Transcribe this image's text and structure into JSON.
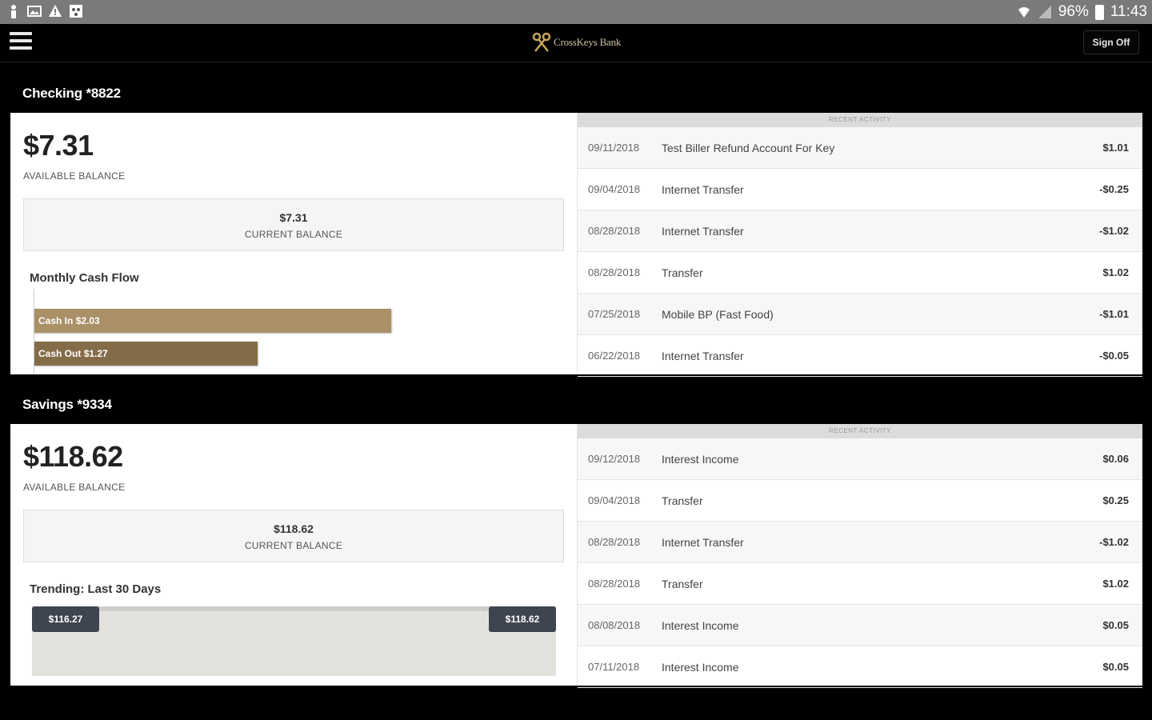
{
  "status_bar": {
    "battery": "96%",
    "time": "11:43"
  },
  "header": {
    "logo_text": "CrossKeys Bank",
    "sign_off": "Sign Off"
  },
  "accounts": [
    {
      "title": "Checking *8822",
      "available_balance": "$7.31",
      "available_label": "AVAILABLE BALANCE",
      "current_balance": "$7.31",
      "current_label": "CURRENT BALANCE",
      "chart_title": "Monthly Cash Flow",
      "cash_in_label": "Cash In",
      "cash_in_value": "$2.03",
      "cash_out_label": "Cash Out",
      "cash_out_value": "$1.27",
      "recent_label": "RECENT ACTIVITY",
      "transactions": [
        {
          "date": "09/11/2018",
          "desc": "Test Biller Refund Account For Key",
          "amount": "$1.01"
        },
        {
          "date": "09/04/2018",
          "desc": "Internet Transfer",
          "amount": "-$0.25"
        },
        {
          "date": "08/28/2018",
          "desc": "Internet Transfer",
          "amount": "-$1.02"
        },
        {
          "date": "08/28/2018",
          "desc": "Transfer",
          "amount": "$1.02"
        },
        {
          "date": "07/25/2018",
          "desc": "Mobile BP (Fast Food)",
          "amount": "-$1.01"
        },
        {
          "date": "06/22/2018",
          "desc": "Internet Transfer",
          "amount": "-$0.05"
        }
      ]
    },
    {
      "title": "Savings *9334",
      "available_balance": "$118.62",
      "available_label": "AVAILABLE BALANCE",
      "current_balance": "$118.62",
      "current_label": "CURRENT BALANCE",
      "chart_title": "Trending: Last 30 Days",
      "trend_start": "$116.27",
      "trend_end": "$118.62",
      "recent_label": "RECENT ACTIVITY",
      "transactions": [
        {
          "date": "09/12/2018",
          "desc": "Interest Income",
          "amount": "$0.06"
        },
        {
          "date": "09/04/2018",
          "desc": "Transfer",
          "amount": "$0.25"
        },
        {
          "date": "08/28/2018",
          "desc": "Internet Transfer",
          "amount": "-$1.02"
        },
        {
          "date": "08/28/2018",
          "desc": "Transfer",
          "amount": "$1.02"
        },
        {
          "date": "08/08/2018",
          "desc": "Interest Income",
          "amount": "$0.05"
        },
        {
          "date": "07/11/2018",
          "desc": "Interest Income",
          "amount": "$0.05"
        }
      ]
    }
  ],
  "chart_data": [
    {
      "type": "bar",
      "title": "Monthly Cash Flow",
      "categories": [
        "Cash In",
        "Cash Out"
      ],
      "values": [
        2.03,
        1.27
      ],
      "xlabel": "",
      "ylabel": ""
    },
    {
      "type": "area",
      "title": "Trending: Last 30 Days",
      "series": [
        {
          "values": [
            116.27,
            118.62
          ]
        }
      ],
      "xlabel": "",
      "ylabel": ""
    }
  ],
  "colors": {
    "cash_in": "#a99066",
    "cash_out": "#846c49",
    "trend_tag": "#3e4450"
  }
}
